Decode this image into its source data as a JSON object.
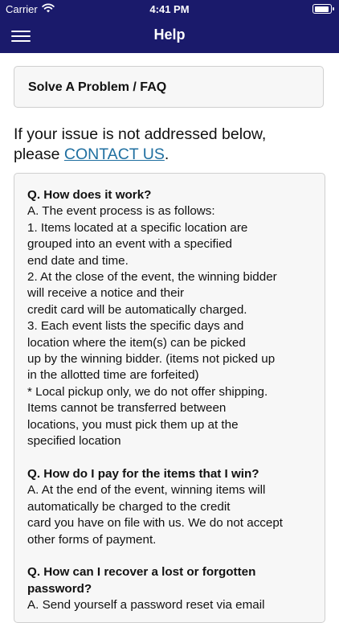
{
  "status_bar": {
    "carrier": "Carrier",
    "time": "4:41 PM"
  },
  "nav": {
    "title": "Help",
    "menu_icon": "hamburger-menu-icon",
    "bar_color": "#1a1a6b"
  },
  "problem_card": {
    "label": "Solve A Problem / FAQ"
  },
  "intro": {
    "line1": "If your issue is not addressed below,",
    "line2_prefix": "please ",
    "link_text": "CONTACT US",
    "line2_suffix": ".",
    "link_color": "#1f6fa0"
  },
  "faq": [
    {
      "question": "Q. How does it work?",
      "answer_lines": [
        "A. The event process is as follows:",
        "1. Items located at a specific location are",
        "grouped into an event with a specified",
        "end date and time.",
        "2. At the close of the event, the winning bidder",
        "will receive a notice and their",
        "credit card will be automatically charged.",
        "3. Each event lists the specific days and",
        "location where the item(s) can be picked",
        "up by the winning bidder.  (items not picked up",
        "in the allotted time are forfeited)",
        "* Local pickup only, we do not offer shipping.",
        "Items cannot be transferred between",
        "locations, you must pick them up at the",
        "specified location"
      ]
    },
    {
      "question": "Q. How do I pay for the items that I win?",
      "answer_lines": [
        "A. At the end of the event, winning items will",
        "automatically be charged to the credit",
        "card you have on file with us.  We do not accept",
        "other forms of payment."
      ]
    },
    {
      "question_lines": [
        "Q. How can I recover a lost or forgotten",
        "password?"
      ],
      "answer_lines": [
        "A. Send yourself a password reset via email"
      ]
    }
  ]
}
